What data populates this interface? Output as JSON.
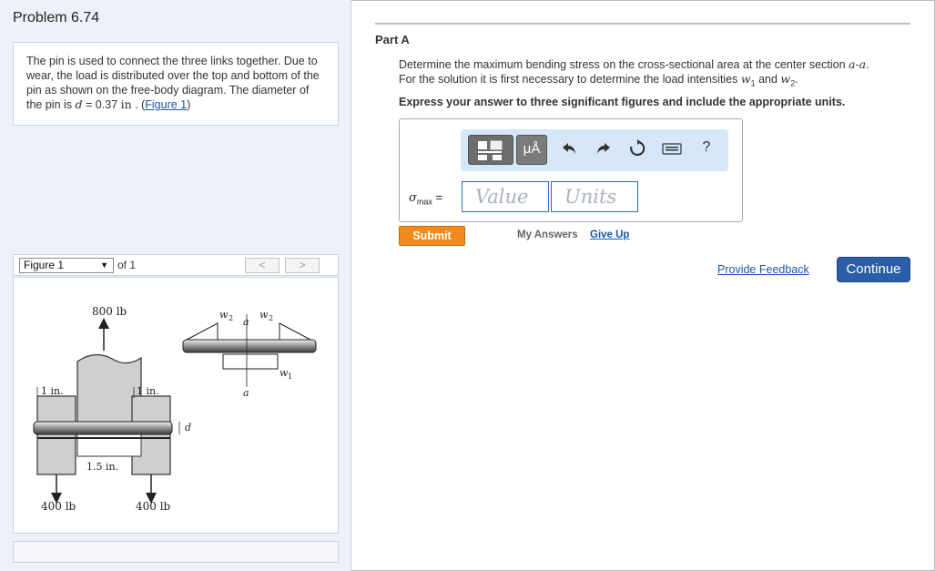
{
  "problem": {
    "title": "Problem 6.74",
    "text_before": "The pin is used to connect the three links together. Due to wear, the load is distributed over the top and bottom of the pin as shown on the free-body diagram. The diameter of the pin is ",
    "d_symbol": "d",
    "equals": " = 0.37 ",
    "unit": "in",
    "text_after": " . (",
    "figure_link": "Figure 1",
    "close_paren": ")"
  },
  "figure_nav": {
    "select_value": "Figure 1",
    "of_text": "of 1",
    "prev": "<",
    "next": ">"
  },
  "figure": {
    "load_top": "800 lb",
    "load_left": "400 lb",
    "load_right": "400 lb",
    "dim_left": "1 in.",
    "dim_right": "1 in.",
    "dim_bottom": "1.5 in.",
    "dim_d": "d",
    "fbd_w2_left": "w",
    "fbd_w2_right": "w",
    "fbd_sub2": "2",
    "fbd_w1": "w",
    "fbd_sub1": "1",
    "section_top": "a",
    "section_bottom": "a"
  },
  "part": {
    "label": "Part A",
    "question_line1": "Determine the maximum bending stress on the cross-sectional area at the center section ",
    "section": "a-a",
    "question_line1_end": ".",
    "question_line2": "For the solution it is first necessary to determine the load intensities ",
    "w1": "w",
    "w1_sub": "1",
    "and": " and ",
    "w2": "w",
    "w2_sub": "2",
    "period": ".",
    "instruction": "Express your answer to three significant figures and include the appropriate units."
  },
  "toolbar": {
    "units_button": "μÅ",
    "help": "?"
  },
  "answer": {
    "sigma": "σ",
    "sub": "max",
    "equals": "=",
    "value_placeholder": "Value",
    "units_placeholder": "Units"
  },
  "actions": {
    "submit": "Submit",
    "my_answers": "My Answers",
    "give_up": "Give Up",
    "feedback": "Provide Feedback",
    "continue": "Continue"
  }
}
